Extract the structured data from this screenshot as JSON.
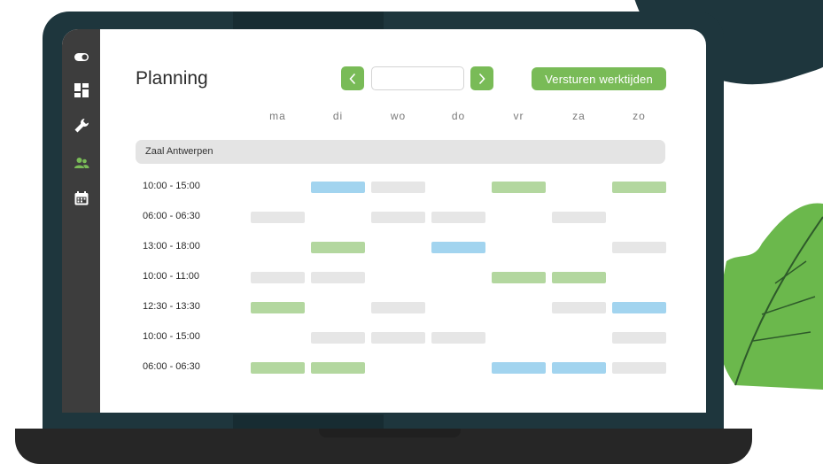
{
  "planner": {
    "title": "Planning",
    "send_label": "Versturen werktijden",
    "date_value": "",
    "days": [
      "ma",
      "di",
      "wo",
      "do",
      "vr",
      "za",
      "zo"
    ],
    "section": "Zaal Antwerpen",
    "rows": [
      {
        "time": "10:00 - 15:00",
        "slots": [
          "",
          "blue",
          "grey",
          "",
          "green",
          "",
          "green"
        ]
      },
      {
        "time": "06:00 - 06:30",
        "slots": [
          "grey",
          "",
          "grey",
          "grey",
          "",
          "grey",
          ""
        ]
      },
      {
        "time": "13:00 - 18:00",
        "slots": [
          "",
          "green",
          "",
          "blue",
          "",
          "",
          "grey"
        ]
      },
      {
        "time": "10:00 - 11:00",
        "slots": [
          "grey",
          "grey",
          "",
          "",
          "green",
          "green",
          ""
        ]
      },
      {
        "time": "12:30 - 13:30",
        "slots": [
          "green",
          "",
          "grey",
          "",
          "",
          "grey",
          "blue"
        ]
      },
      {
        "time": "10:00 - 15:00",
        "slots": [
          "",
          "grey",
          "grey",
          "grey",
          "",
          "",
          "grey"
        ]
      },
      {
        "time": "06:00 - 06:30",
        "slots": [
          "green",
          "green",
          "",
          "",
          "blue",
          "blue",
          "grey"
        ]
      }
    ]
  },
  "sidebar": {
    "icons": [
      "toggle-icon",
      "dashboard-icon",
      "wrench-icon",
      "users-icon",
      "calendar-icon"
    ],
    "active": "users-icon"
  },
  "colors": {
    "accent": "#79bb57",
    "blue": "#a2d4ef",
    "grey": "#e6e6e6",
    "sidebar": "#3d3d3d"
  }
}
